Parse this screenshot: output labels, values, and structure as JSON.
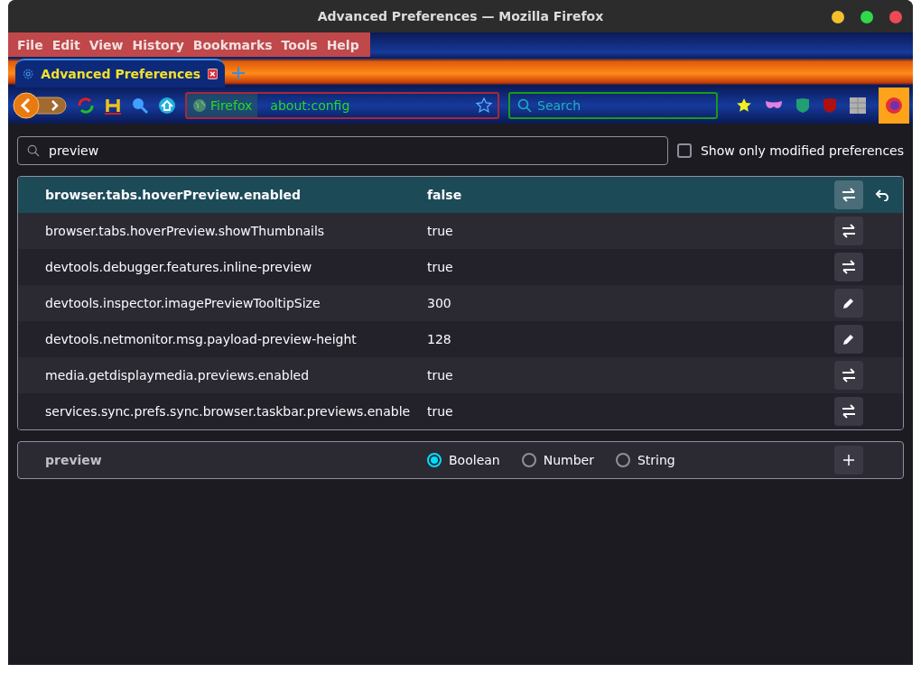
{
  "window": {
    "title": "Advanced Preferences — Mozilla Firefox"
  },
  "menu": [
    "File",
    "Edit",
    "View",
    "History",
    "Bookmarks",
    "Tools",
    "Help"
  ],
  "tab": {
    "label": "Advanced Preferences",
    "selected": true
  },
  "urlbar": {
    "identity": "Firefox",
    "value": "about:config"
  },
  "searchbar": {
    "placeholder": "Search"
  },
  "filter": {
    "value": "preview",
    "show_modified_label": "Show only modified preferences",
    "show_modified_checked": false
  },
  "prefs": [
    {
      "name": "browser.tabs.hoverPreview.enabled",
      "value": "false",
      "kind": "toggle",
      "modified": true
    },
    {
      "name": "browser.tabs.hoverPreview.showThumbnails",
      "value": "true",
      "kind": "toggle",
      "modified": false
    },
    {
      "name": "devtools.debugger.features.inline-preview",
      "value": "true",
      "kind": "toggle",
      "modified": false
    },
    {
      "name": "devtools.inspector.imagePreviewTooltipSize",
      "value": "300",
      "kind": "edit",
      "modified": false
    },
    {
      "name": "devtools.netmonitor.msg.payload-preview-height",
      "value": "128",
      "kind": "edit",
      "modified": false
    },
    {
      "name": "media.getdisplaymedia.previews.enabled",
      "value": "true",
      "kind": "toggle",
      "modified": false
    },
    {
      "name": "services.sync.prefs.sync.browser.taskbar.previews.enable",
      "value": "true",
      "kind": "toggle",
      "modified": false
    }
  ],
  "new_pref": {
    "name": "preview",
    "types": [
      {
        "label": "Boolean",
        "selected": true
      },
      {
        "label": "Number",
        "selected": false
      },
      {
        "label": "String",
        "selected": false
      }
    ]
  }
}
